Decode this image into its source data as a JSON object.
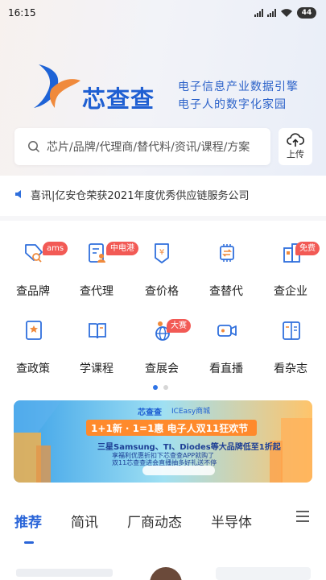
{
  "status_bar": {
    "time": "16:15",
    "battery": "44"
  },
  "brand": {
    "name": "芯查查",
    "slogan_line1": "电子信息产业数据引擎",
    "slogan_line2": "电子人的数字化家园"
  },
  "search": {
    "placeholder": "芯片/品牌/代理商/替代料/资讯/课程/方案",
    "upload_label": "上传"
  },
  "news": {
    "text": "喜讯|亿安仓荣获2021年度优秀供应链服务公司"
  },
  "quick_actions": [
    {
      "label": "查品牌",
      "badge": "ams",
      "icon": "brand-search-icon"
    },
    {
      "label": "查代理",
      "badge": "中电港",
      "icon": "agent-icon"
    },
    {
      "label": "查价格",
      "badge": "",
      "icon": "price-tag-icon"
    },
    {
      "label": "查替代",
      "badge": "",
      "icon": "chip-replace-icon"
    },
    {
      "label": "查企业",
      "badge": "免费",
      "icon": "company-building-icon"
    },
    {
      "label": "查政策",
      "badge": "",
      "icon": "policy-book-icon"
    },
    {
      "label": "学课程",
      "badge": "",
      "icon": "course-book-icon"
    },
    {
      "label": "查展会",
      "badge": "大赛",
      "icon": "expo-globe-icon"
    },
    {
      "label": "看直播",
      "badge": "",
      "icon": "live-camera-icon"
    },
    {
      "label": "看杂志",
      "badge": "",
      "icon": "magazine-icon"
    }
  ],
  "banner": {
    "logo_text": "芯查查",
    "partner_text": "ICEasy商城",
    "headline": "1+1新 · 1=1惠 电子人双11狂欢节",
    "subline": "三星Samsung、TI、Diodes等大品牌低至1折起",
    "promo_line1": "享福利优惠折扣下芯查查APP就购了",
    "promo_line2": "双11芯查查进会直播抽多好礼送不停"
  },
  "tabs": [
    "推荐",
    "简讯",
    "厂商动态",
    "半导体"
  ],
  "colors": {
    "accent": "#2a65d8",
    "badge": "#f25a55",
    "icon_blue": "#2f6fdc",
    "icon_orange": "#f08a3c"
  }
}
